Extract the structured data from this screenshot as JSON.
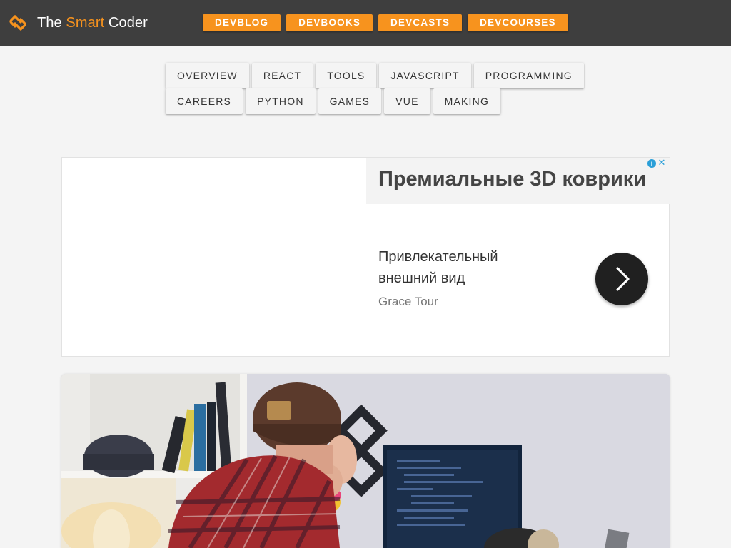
{
  "header": {
    "brand_prefix": "The ",
    "brand_accent": "Smart",
    "brand_suffix": " Coder",
    "nav": [
      "DEVBLOG",
      "DEVBOOKS",
      "DEVCASTS",
      "DEVCOURSES"
    ]
  },
  "categories": {
    "row1": [
      "OVERVIEW",
      "REACT",
      "TOOLS",
      "JAVASCRIPT",
      "PROGRAMMING"
    ],
    "row2": [
      "CAREERS",
      "PYTHON",
      "GAMES",
      "VUE",
      "MAKING"
    ]
  },
  "ad": {
    "headline": "Премиальные 3D коврики",
    "body": "Привлекательный внешний вид",
    "advertiser": "Grace Tour",
    "info_glyph": "i",
    "close_glyph": "✕"
  },
  "icons": [
    "logo-icon",
    "ad-info-icon",
    "ad-close-icon",
    "chevron-right-icon"
  ],
  "colors": {
    "header_bg": "#3e3e3e",
    "accent": "#f7931e",
    "page_bg": "#f4f4f4"
  }
}
